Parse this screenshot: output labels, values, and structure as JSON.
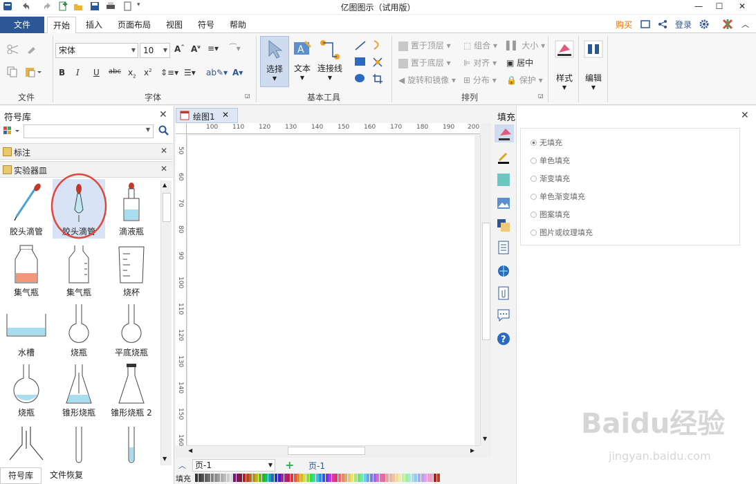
{
  "window": {
    "title": "亿图图示（试用版）"
  },
  "menu": {
    "file": "文件",
    "tabs": [
      "开始",
      "插入",
      "页面布局",
      "视图",
      "符号",
      "帮助"
    ],
    "right": {
      "buy": "购买",
      "login": "登录"
    }
  },
  "ribbon": {
    "font_name": "宋体",
    "font_size": "10",
    "groups": {
      "file": "文件",
      "font": "字体",
      "basic_tools": "基本工具",
      "arrange": "排列"
    },
    "tools": {
      "select": "选择",
      "text": "文本",
      "connector": "连接线"
    },
    "arrange": {
      "bring_front": "置于顶层",
      "send_back": "置于底层",
      "rotate_mirror": "旋转和镜像",
      "group": "组合",
      "align": "对齐",
      "distribute": "分布",
      "size": "大小",
      "center": "居中",
      "protect": "保护"
    },
    "style": "样式",
    "edit": "编辑"
  },
  "library": {
    "title": "符号库",
    "sections": [
      "标注",
      "实验器皿"
    ],
    "items": [
      "胶头滴管",
      "胶头滴管",
      "滴液瓶",
      "集气瓶",
      "集气瓶",
      "烧杯",
      "水槽",
      "烧瓶",
      "平底烧瓶",
      "烧瓶",
      "锥形烧瓶",
      "锥形烧瓶 2"
    ],
    "bottom_tabs": [
      "符号库",
      "文件恢复"
    ]
  },
  "document": {
    "tab": "绘图1",
    "hruler": [
      "100",
      "110",
      "120",
      "130",
      "140",
      "150",
      "160",
      "170",
      "180",
      "190",
      "200"
    ],
    "vruler": [
      "50",
      "60",
      "70",
      "80",
      "90",
      "100",
      "110",
      "120",
      "130",
      "140",
      "150",
      "160"
    ],
    "page_select": "页-1",
    "page_tab": "页-1",
    "fill_label": "填充"
  },
  "fill_panel": {
    "title": "填充",
    "options": [
      "无填充",
      "单色填充",
      "渐变填充",
      "单色渐变填充",
      "图案填充",
      "图片或纹理填充"
    ]
  },
  "watermark": {
    "main": "Baidu经验",
    "sub": "jingyan.baidu.com"
  }
}
